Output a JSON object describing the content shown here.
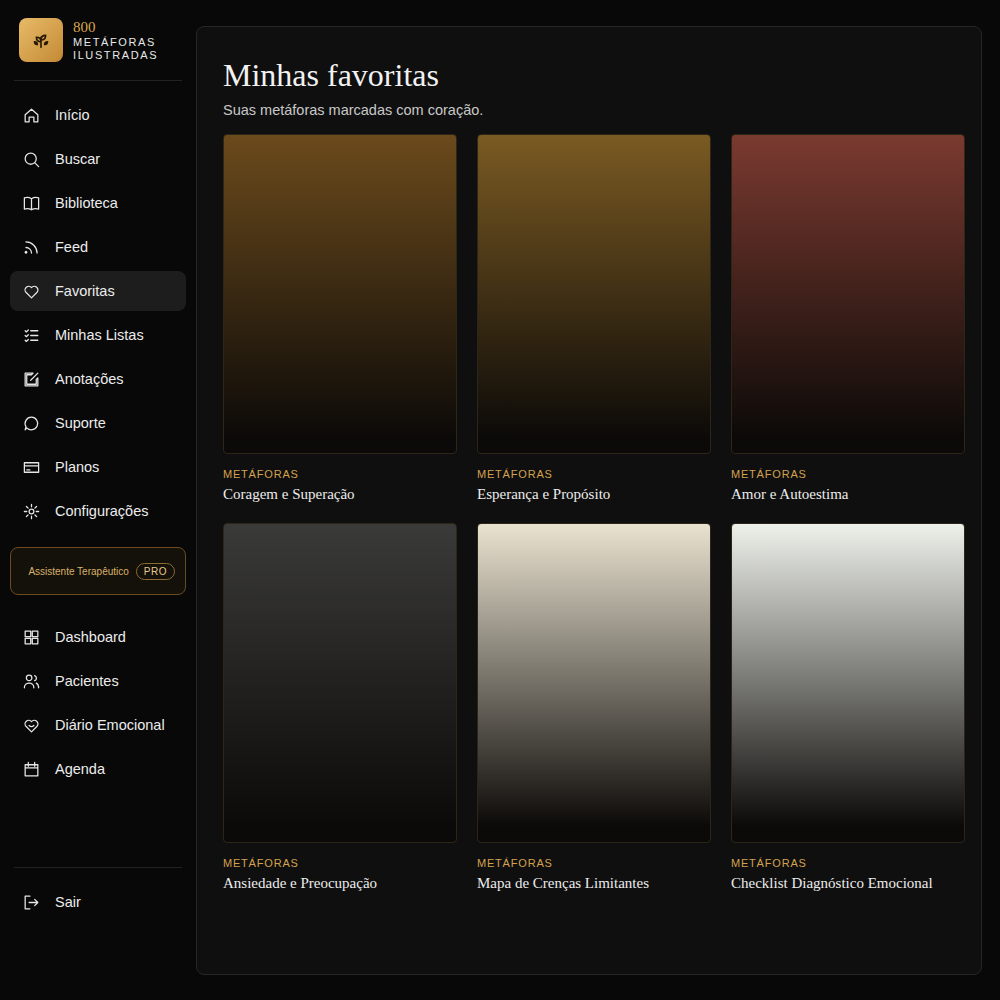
{
  "sidebar": {
    "logo": {
      "number": "800",
      "line1": "METÁFORAS",
      "line2": "ILUSTRADAS"
    },
    "items": [
      {
        "label": "Início",
        "selected": false
      },
      {
        "label": "Buscar",
        "selected": false
      },
      {
        "label": "Biblioteca",
        "selected": false
      },
      {
        "label": "Feed",
        "selected": false
      },
      {
        "label": "Favoritas",
        "selected": true
      },
      {
        "label": "Minhas Listas",
        "selected": false
      },
      {
        "label": "Anotações",
        "selected": false
      },
      {
        "label": "Suporte",
        "selected": false
      },
      {
        "label": "Planos",
        "selected": false
      },
      {
        "label": "Configurações",
        "selected": false
      }
    ],
    "assistant": {
      "label": "Assistente Terapêutico",
      "badge": "PRO"
    },
    "pro_items": [
      {
        "label": "Dashboard",
        "selected": false
      },
      {
        "label": "Pacientes",
        "selected": false
      },
      {
        "label": "Diário Emocional",
        "selected": false
      },
      {
        "label": "Agenda",
        "selected": false
      }
    ],
    "logout": "Sair"
  },
  "main": {
    "title": "Minhas favoritas",
    "subtitle": "Suas metáforas marcadas com coração.",
    "cards": [
      {
        "category": "METÁFORAS",
        "title": "Coragem e Superação",
        "color": "#6b4a1c"
      },
      {
        "category": "METÁFORAS",
        "title": "Esperança e Propósito",
        "color": "#7a5a22"
      },
      {
        "category": "METÁFORAS",
        "title": "Amor e Autoestima",
        "color": "#7a3a30"
      },
      {
        "category": "METÁFORAS",
        "title": "Ansiedade e Preocupação",
        "color": "#3a3a38"
      },
      {
        "category": "METÁFORAS",
        "title": "Mapa de Crenças Limitantes",
        "color": "#e9e2d0"
      },
      {
        "category": "METÁFORAS",
        "title": "Checklist Diagnóstico Emocional",
        "color": "#eef0ea"
      }
    ]
  }
}
